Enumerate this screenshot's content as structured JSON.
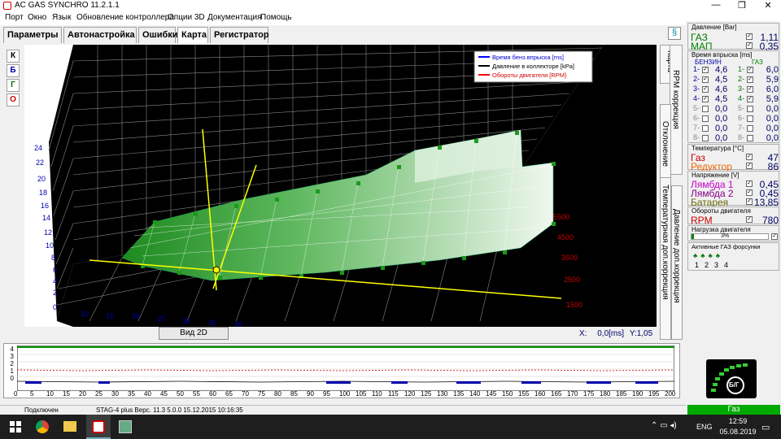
{
  "title_bar": {
    "title": "AC GAS SYNCHRO  11.2.1.1"
  },
  "menu": [
    "Порт",
    "Окно",
    "Язык",
    "Обновление контроллера",
    "Опции 3D",
    "Документация",
    "Помощь"
  ],
  "tabs": [
    "Параметры",
    "Автонастройка",
    "Ошибки",
    "Карта",
    "Регистратор"
  ],
  "side_buttons": [
    "К",
    "Б",
    "Г",
    "О"
  ],
  "legend": [
    "Время бенз.впрыска [ms]",
    "Давление в коллекторе [kPa]",
    "Обороты двигателя [RPM]"
  ],
  "y_ticks": [
    "24",
    "22",
    "20",
    "18",
    "16",
    "14",
    "12",
    "10",
    "8",
    "6",
    "4",
    "2",
    "0"
  ],
  "x_ticks": [
    "10",
    "15",
    "20",
    "25",
    "30",
    "35",
    "40"
  ],
  "rpm_ticks": [
    "5500",
    "4500",
    "3500",
    "2500",
    "1500"
  ],
  "view2d_button": "Вид 2D",
  "xy_readout": {
    "x_label": "X:",
    "x_value": "0,0[ms]",
    "y_label": "Y:",
    "y_value": "1,05"
  },
  "vertical_tabs": [
    "Карта",
    "RPM коррекция",
    "Отклонение",
    "Температурная доп.коррекция",
    "Давление доп.коррекция"
  ],
  "pressure": {
    "title": "Давление [Bar]",
    "gas_label": "ГАЗ",
    "gas_value": "1,11",
    "map_label": "МАП",
    "map_value": "0,35"
  },
  "injection": {
    "title": "Время впрыска [ms]",
    "benzin_label": "БЕНЗИН",
    "gas_label": "ГАЗ",
    "rows": [
      {
        "n": "1-",
        "bv": "4,6",
        "gn": "1-",
        "gv": "6,0",
        "active": true
      },
      {
        "n": "2-",
        "bv": "4,5",
        "gn": "2-",
        "gv": "5,9",
        "active": true
      },
      {
        "n": "3-",
        "bv": "4,6",
        "gn": "3-",
        "gv": "6,0",
        "active": true
      },
      {
        "n": "4-",
        "bv": "4,5",
        "gn": "4-",
        "gv": "5,9",
        "active": true
      },
      {
        "n": "5-",
        "bv": "0,0",
        "gn": "5-",
        "gv": "0,0",
        "active": false
      },
      {
        "n": "6-",
        "bv": "0,0",
        "gn": "6-",
        "gv": "0,0",
        "active": false
      },
      {
        "n": "7-",
        "bv": "0,0",
        "gn": "7-",
        "gv": "0,0",
        "active": false
      },
      {
        "n": "8-",
        "bv": "0,0",
        "gn": "8-",
        "gv": "0,0",
        "active": false
      }
    ]
  },
  "temperature": {
    "title": "Температура [°C]",
    "gas_label": "Газ",
    "gas_value": "47",
    "reducer_label": "Редуктор",
    "reducer_value": "86"
  },
  "voltage": {
    "title": "Напряжение [V]",
    "l1_label": "Лямбда 1",
    "l1_value": "0,45",
    "l2_label": "Лямбда 2",
    "l2_value": "0,45",
    "bat_label": "Батарея",
    "bat_value": "13,85"
  },
  "rpm": {
    "title": "Обороты двигателя",
    "label": "RPM",
    "value": "780"
  },
  "load": {
    "title": "Нагрузка двигателя",
    "value": "3%",
    "fraction": 0.03
  },
  "injectors": {
    "title": "Активные ГАЗ форсунки",
    "labels": [
      "1",
      "2",
      "3",
      "4"
    ]
  },
  "fuel_status": {
    "button_label": "Б/Г",
    "bar_label": "Газ"
  },
  "timeline_ticks": [
    "0",
    "5",
    "10",
    "15",
    "20",
    "25",
    "30",
    "35",
    "40",
    "45",
    "50",
    "55",
    "60",
    "65",
    "70",
    "75",
    "80",
    "85",
    "90",
    "95",
    "100",
    "105",
    "110",
    "115",
    "120",
    "125",
    "130",
    "135",
    "140",
    "145",
    "150",
    "155",
    "160",
    "165",
    "170",
    "175",
    "180",
    "185",
    "190",
    "195",
    "200"
  ],
  "timeline_y": [
    "4",
    "3",
    "2",
    "1",
    "0"
  ],
  "status_bar": {
    "connection": "Подключен",
    "device": "STAG-4 plus  Верс. 11.3  5.0.0    15.12.2015 10:16:35"
  },
  "taskbar": {
    "lang": "ENG",
    "time": "12:59",
    "date": "05.08.2019"
  }
}
